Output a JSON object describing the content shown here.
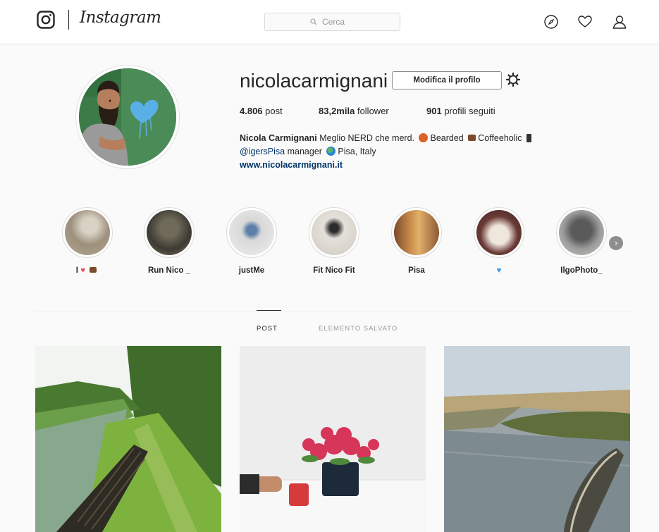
{
  "header": {
    "brand": "Instagram",
    "search_placeholder": "Cerca",
    "icons": [
      "explore-compass-icon",
      "activity-heart-icon",
      "profile-person-icon"
    ]
  },
  "profile": {
    "username": "nicolacarmignani",
    "edit_button": "Modifica il profilo",
    "stats": {
      "posts_count": "4.806",
      "posts_label": "post",
      "followers_count": "83,2mila",
      "followers_label": "follower",
      "following_count": "901",
      "following_label": "profili seguiti"
    },
    "bio": {
      "full_name": "Nicola Carmignani",
      "line1_text": "Meglio NERD che merd.",
      "bearded": "Bearded",
      "coffeeholic": "Coffeeholic",
      "mention": "@igersPisa",
      "manager": "manager",
      "location": "Pisa, Italy",
      "website": "www.nicolacarmignani.it"
    }
  },
  "highlights": [
    {
      "label": "I"
    },
    {
      "label": "Run Nico _"
    },
    {
      "label": "justMe"
    },
    {
      "label": "Fit Nico Fit"
    },
    {
      "label": "Pisa"
    },
    {
      "label": ""
    },
    {
      "label": "IlgoPhoto_"
    }
  ],
  "tabs": {
    "posts": "POST",
    "saved": "ELEMENTO SALVATO"
  },
  "colors": {
    "link": "#003569",
    "text": "#262626",
    "background": "#fafafa",
    "heart_red": "#ed4956",
    "heart_blue": "#3897f0"
  }
}
